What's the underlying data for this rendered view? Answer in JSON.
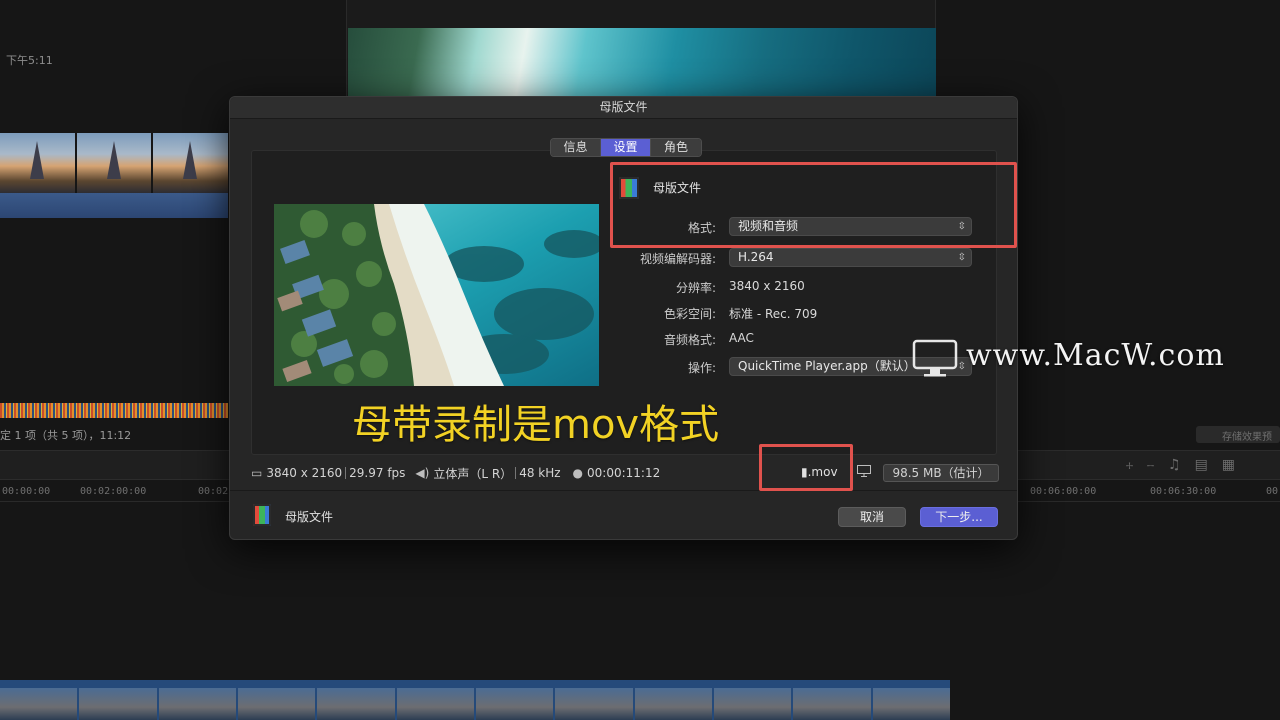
{
  "background": {
    "clock": "下午5:11",
    "selection_info": "定 1 项（共 5 项），11:12",
    "save_effects_button": "存储效果预",
    "timecodes": [
      "00:00:00",
      "00:02:00:00",
      "00:02",
      "00:06:00:00",
      "00:06:30:00",
      "00"
    ]
  },
  "dialog": {
    "title": "母版文件",
    "tabs": [
      {
        "label": "信息",
        "active": false
      },
      {
        "label": "设置",
        "active": true
      },
      {
        "label": "角色",
        "active": false
      }
    ],
    "settings": {
      "title": "母版文件",
      "format_label": "格式:",
      "format_value": "视频和音频",
      "codec_label": "视频编解码器:",
      "codec_value": "H.264",
      "resolution_label": "分辨率:",
      "resolution_value": "3840 x 2160",
      "colorspace_label": "色彩空间:",
      "colorspace_value": "标准 - Rec. 709",
      "audio_label": "音频格式:",
      "audio_value": "AAC",
      "action_label": "操作:",
      "action_value": "QuickTime Player.app（默认）"
    },
    "info_bar": {
      "resolution": "3840 x 2160",
      "fps": "29.97 fps",
      "audio": "立体声（L R）",
      "sample_rate": "48 kHz",
      "duration": "00:00:11:12",
      "extension": ".mov",
      "size": "98.5 MB（估计）"
    },
    "footer": {
      "title": "母版文件",
      "cancel_label": "取消",
      "next_label": "下一步..."
    }
  },
  "overlay": {
    "caption": "母带录制是mov格式",
    "watermark": "www.MacW.com"
  },
  "colors": {
    "accent": "#5b5fd3",
    "highlight_box": "#e0524d",
    "caption": "#f2d224"
  }
}
